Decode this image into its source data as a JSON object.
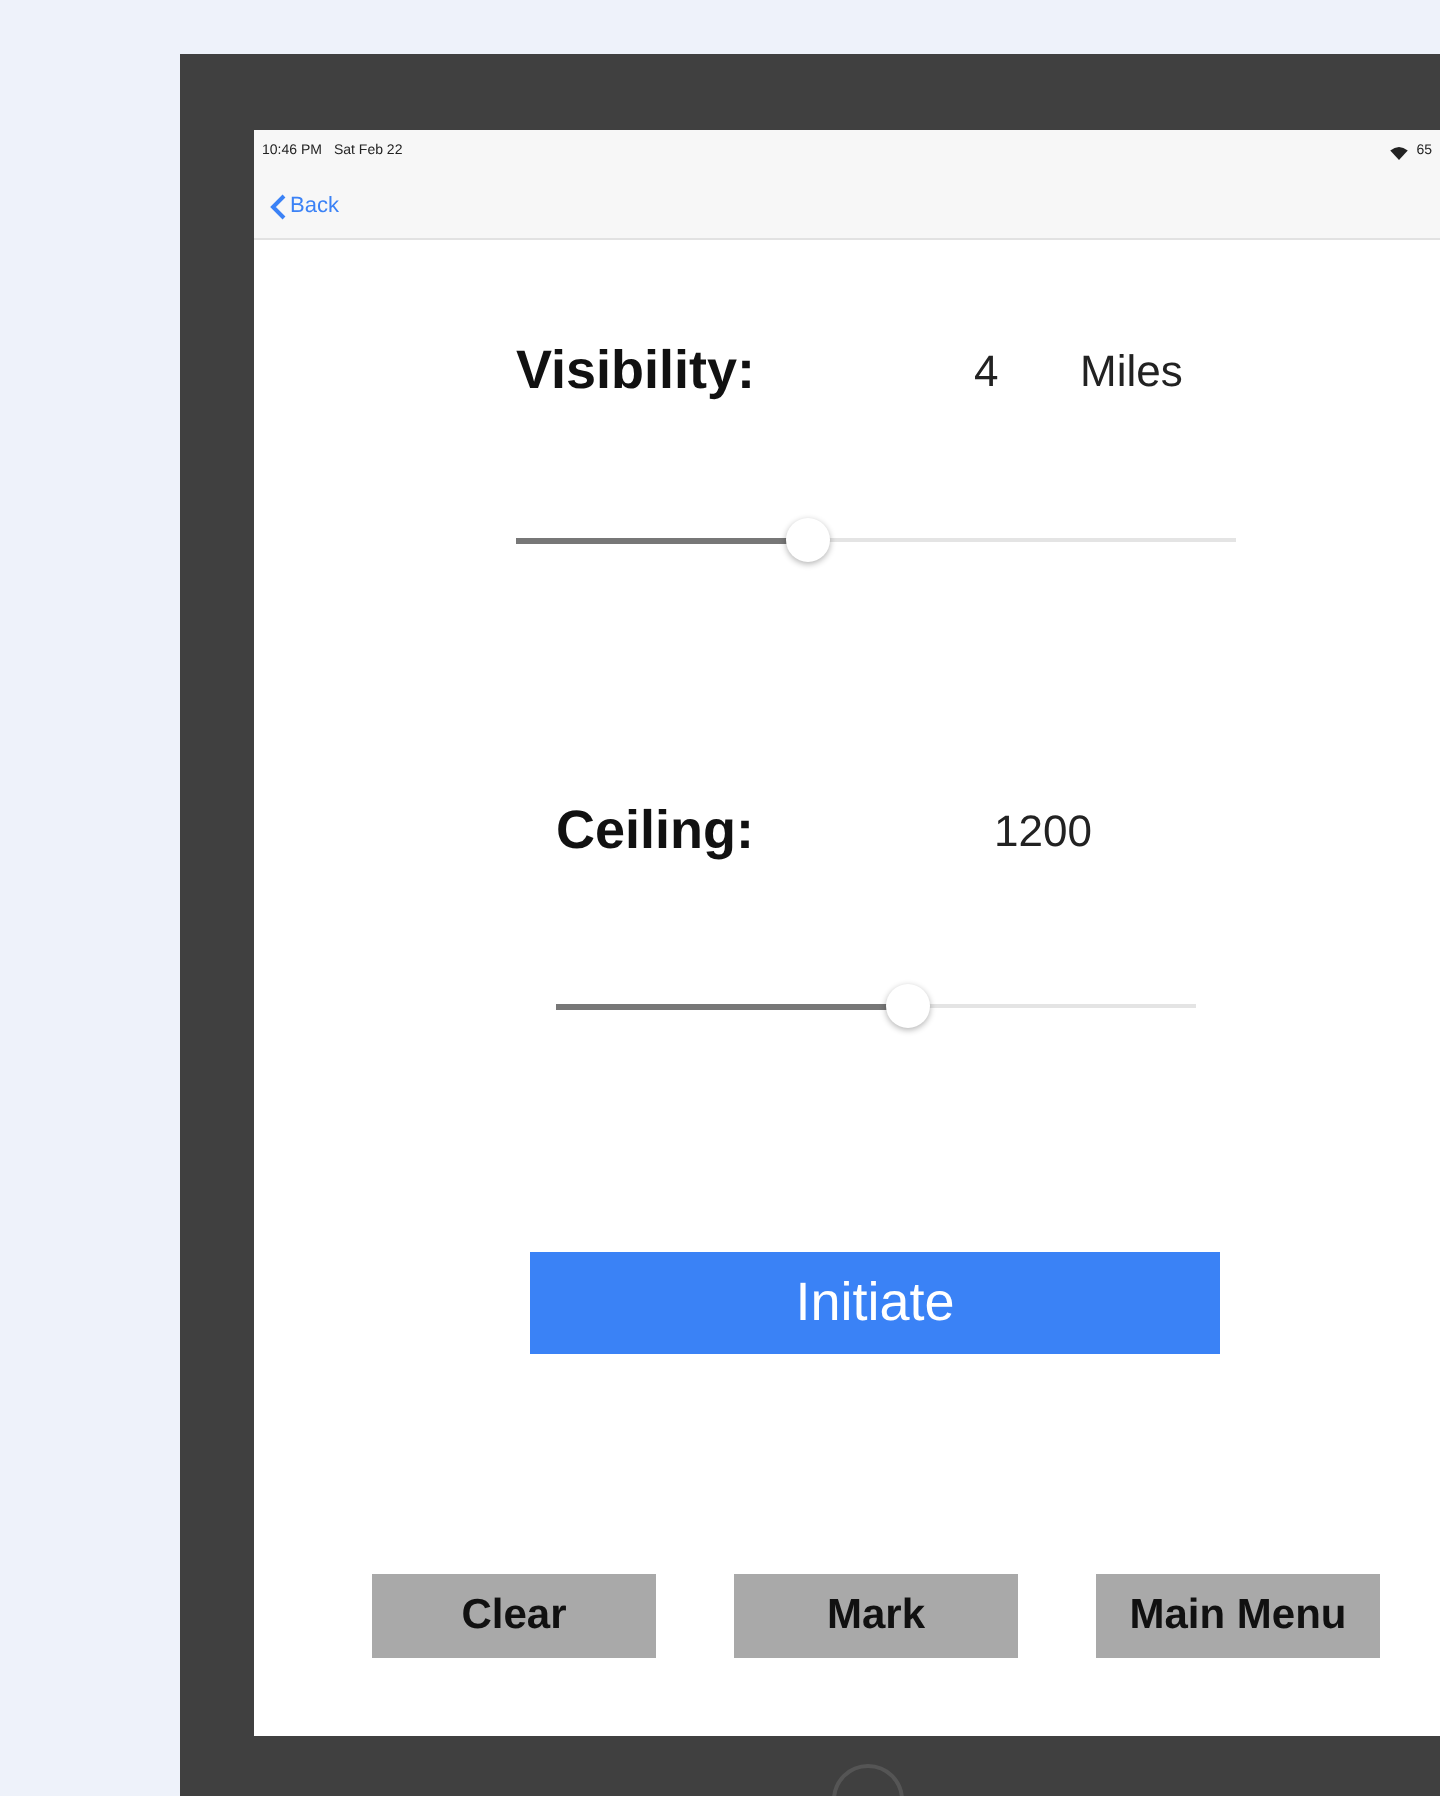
{
  "status_bar": {
    "time": "10:46 PM",
    "date": "Sat Feb 22",
    "battery": "65"
  },
  "nav": {
    "back": "Back"
  },
  "sliders": [
    {
      "label": "Visibility:",
      "value": "4",
      "unit": "Miles",
      "level": 0.405
    },
    {
      "label": "Ceiling:",
      "value": "1200",
      "level": 0.55
    }
  ],
  "primary_button": "Initiate",
  "buttons": [
    "Clear",
    "Mark",
    "Main Menu"
  ]
}
